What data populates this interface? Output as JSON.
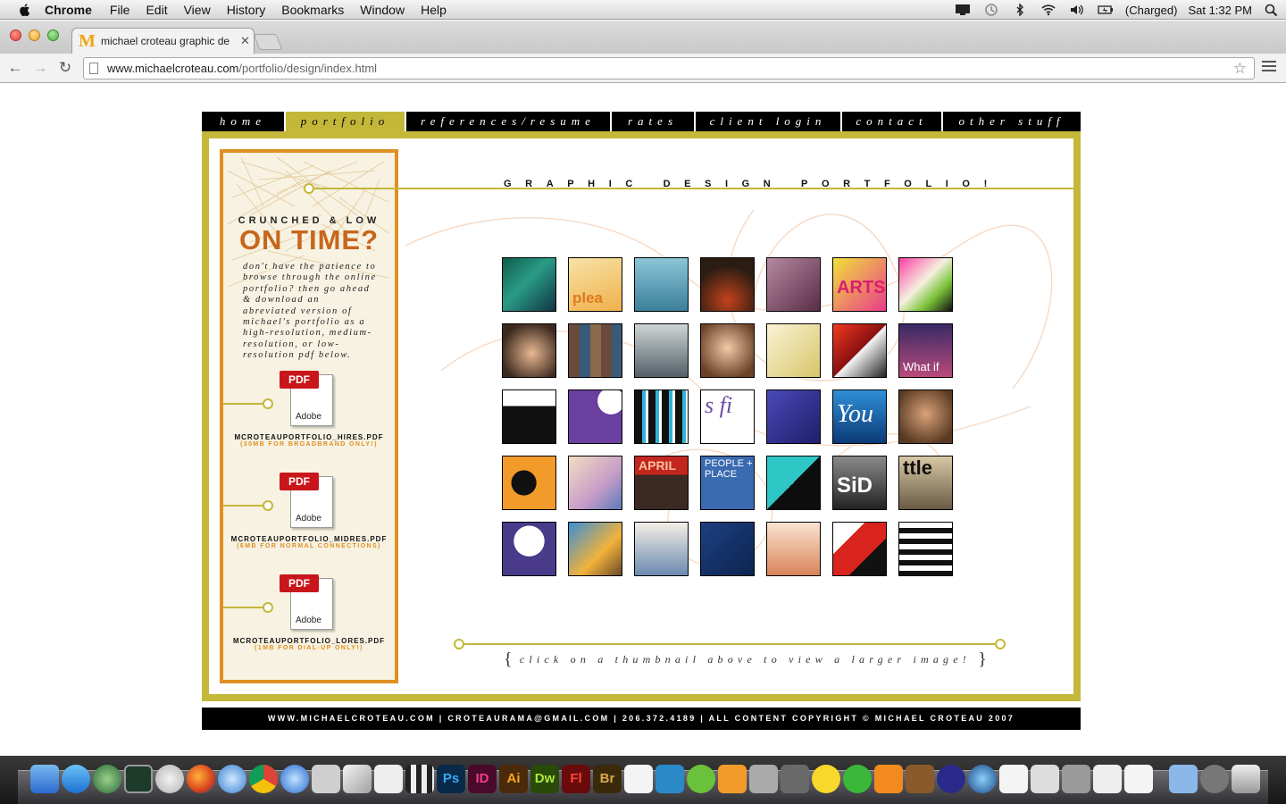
{
  "menubar": {
    "app": "Chrome",
    "items": [
      "File",
      "Edit",
      "View",
      "History",
      "Bookmarks",
      "Window",
      "Help"
    ],
    "battery": "(Charged)",
    "clock": "Sat 1:32 PM"
  },
  "browser": {
    "tab_title": "michael croteau graphic de",
    "tab_favicon": "M",
    "url_host": "www.michaelcroteau.com",
    "url_path": "/portfolio/design/index.html"
  },
  "nav": {
    "items": [
      "home",
      "portfolio",
      "references/resume",
      "rates",
      "client login",
      "contact",
      "other stuff"
    ],
    "active": "portfolio"
  },
  "sidebar": {
    "kicker": "CRUNCHED & LOW",
    "headline": "ON TIME?",
    "body": "don't have the patience to browse through the online portfolio? then go ahead & download an abreviated version of michael's portfolio as a high-resolution, medium-resolution, or low-resolution pdf below.",
    "downloads": [
      {
        "tag": "PDF",
        "brand": "Adobe",
        "file": "MCROTEAUPORTFOLIO_HIRES.PDF",
        "note": "(30MB FOR BROADBRAND ONLY!)"
      },
      {
        "tag": "PDF",
        "brand": "Adobe",
        "file": "MCROTEAUPORTFOLIO_MIDRES.PDF",
        "note": "(6MB FOR NORMAL CONNECTIONS)"
      },
      {
        "tag": "PDF",
        "brand": "Adobe",
        "file": "MCROTEAUPORTFOLIO_LORES.PDF",
        "note": "(1MB FOR DIAL-UP ONLY!)"
      }
    ]
  },
  "main": {
    "heading": "GRAPHIC DESIGN PORTFOLIO!",
    "caption": "click on a thumbnail above to view a larger image!",
    "thumb_texts": {
      "t2": "plea",
      "t6": "ARTS",
      "t14": "What if",
      "t18": "s fi",
      "t20": "You",
      "t24": "APRIL",
      "t25": "PEOPLE + PLACE",
      "t27": "SiD",
      "t28": "ttle"
    }
  },
  "footer": {
    "text": "WWW.MICHAELCROTEAU.COM | CROTEAURAMA@GMAIL.COM | 206.372.4189 | ALL CONTENT COPYRIGHT © MICHAEL CROTEAU 2007"
  },
  "dock": {
    "labels": [
      "Ps",
      "ID",
      "Ai",
      "Dw",
      "Fl",
      "Br"
    ]
  },
  "colors": {
    "frame": "#c4b73a",
    "sidebar_border": "#e08f22",
    "headline": "#c7661c",
    "pdf_red": "#c8161b"
  }
}
